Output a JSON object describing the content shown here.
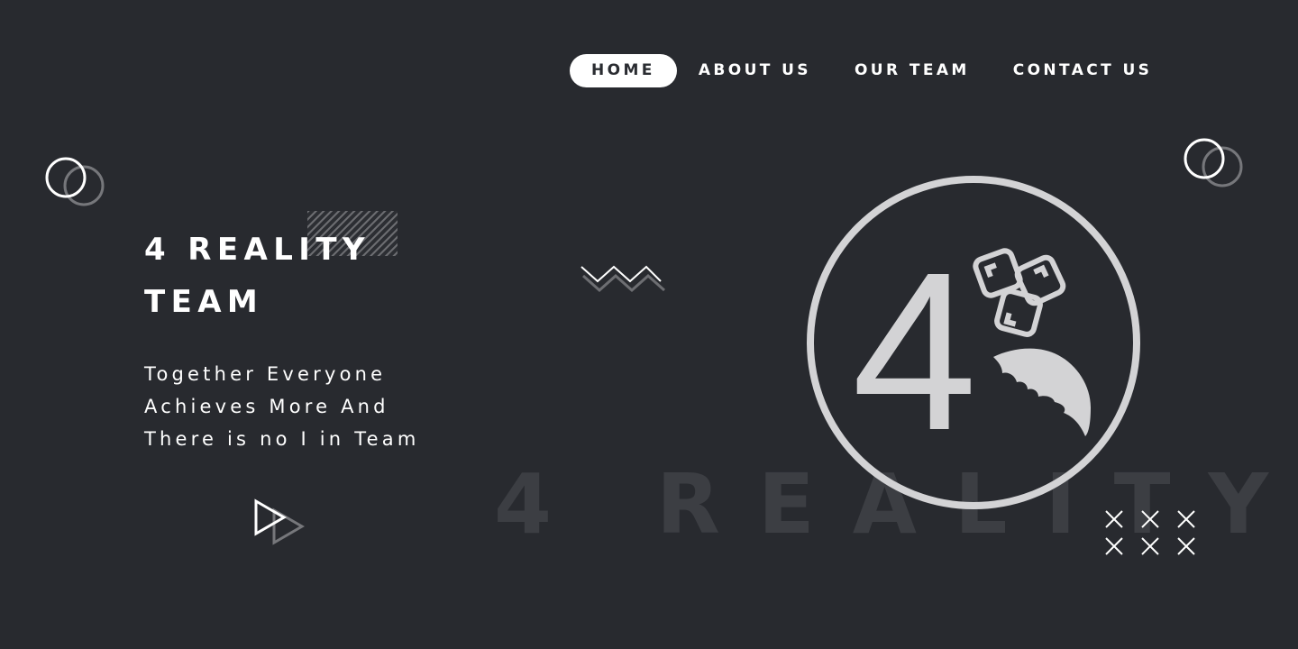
{
  "nav": {
    "items": [
      {
        "label": "HOME",
        "active": true
      },
      {
        "label": "ABOUT US",
        "active": false
      },
      {
        "label": "OUR TEAM",
        "active": false
      },
      {
        "label": "CONTACT US",
        "active": false
      }
    ]
  },
  "hero": {
    "title_line1": "4 REALITY",
    "title_line2": "TEAM",
    "tagline_line1": "Together Everyone",
    "tagline_line2": "Achieves More And",
    "tagline_line3": "There is no I in Team"
  },
  "watermark": "4 REALITY",
  "logo": {
    "numeral": "4",
    "icon_names": [
      "circle-ring",
      "dice-icon",
      "fox-tail-icon"
    ]
  },
  "colors": {
    "background": "#282a2f",
    "text": "#ffffff",
    "logo": "#d3d3d5",
    "watermark": "#3c3e43",
    "decoration_muted": "#76777b"
  },
  "icons": [
    "double-circle-icon",
    "zigzag-icon",
    "play-triangle-icon",
    "cross-grid-icon",
    "hatch-pattern"
  ]
}
